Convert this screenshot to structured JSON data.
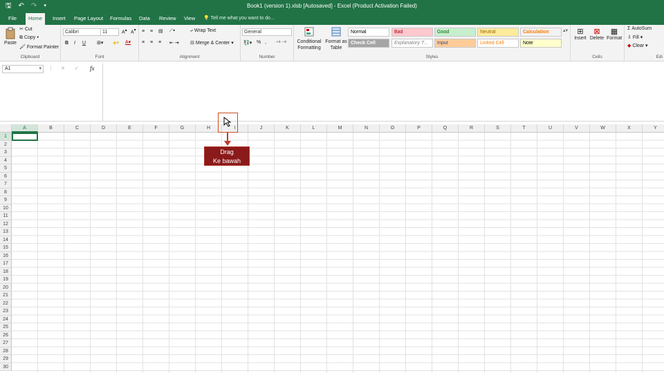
{
  "window": {
    "title": "Book1 (version 1).xlsb [Autosaved] - Excel (Product Activation Failed)"
  },
  "qat": {
    "save": "🖫",
    "undo": "↶",
    "redo": "↷",
    "more": "▾"
  },
  "tabs": [
    "File",
    "Home",
    "Insert",
    "Page Layout",
    "Formulas",
    "Data",
    "Review",
    "View"
  ],
  "active_tab": "Home",
  "tell_me": "Tell me what you want to do...",
  "clipboard": {
    "paste": "Paste",
    "cut": "Cut",
    "copy": "Copy",
    "format_painter": "Format Painter",
    "label": "Clipboard"
  },
  "font": {
    "name": "Calibri",
    "size": "11",
    "bold": "B",
    "italic": "I",
    "underline": "U",
    "label": "Font"
  },
  "alignment": {
    "wrap": "Wrap Text",
    "merge": "Merge & Center",
    "label": "Alignment"
  },
  "number": {
    "format": "General",
    "percent": "%",
    "comma": ",",
    "label": "Number"
  },
  "styles": {
    "conditional": [
      "Conditional",
      "Formatting"
    ],
    "format_table": [
      "Format as",
      "Table"
    ],
    "cells": [
      {
        "label": "Normal",
        "bg": "#ffffff",
        "fg": "#000000"
      },
      {
        "label": "Bad",
        "bg": "#ffc7ce",
        "fg": "#9c0006"
      },
      {
        "label": "Good",
        "bg": "#c6efce",
        "fg": "#006100"
      },
      {
        "label": "Neutral",
        "bg": "#ffeb9c",
        "fg": "#9c6500"
      },
      {
        "label": "Calculation",
        "bg": "#f2f2f2",
        "fg": "#fa7d00"
      },
      {
        "label": "Check Cell",
        "bg": "#a5a5a5",
        "fg": "#ffffff"
      },
      {
        "label": "Explanatory T...",
        "bg": "#ffffff",
        "fg": "#7f7f7f"
      },
      {
        "label": "Input",
        "bg": "#ffcc99",
        "fg": "#3f3f76"
      },
      {
        "label": "Linked Cell",
        "bg": "#ffffff",
        "fg": "#fa7d00"
      },
      {
        "label": "Note",
        "bg": "#ffffcc",
        "fg": "#000000"
      }
    ],
    "label": "Styles"
  },
  "cells_group": {
    "insert": "Insert",
    "delete": "Delete",
    "format": "Format",
    "label": "Cells"
  },
  "editing": {
    "autosum": "AutoSum",
    "fill": "Fill",
    "clear": "Clear",
    "label": "Edi"
  },
  "name_box": "A1",
  "fx": "fx",
  "columns": [
    "A",
    "B",
    "C",
    "D",
    "E",
    "F",
    "G",
    "H",
    "I",
    "J",
    "K",
    "L",
    "M",
    "N",
    "O",
    "P",
    "Q",
    "R",
    "S",
    "T",
    "U",
    "V",
    "W",
    "X",
    "Y"
  ],
  "rows": [
    "1",
    "2",
    "3",
    "4",
    "5",
    "6",
    "7",
    "8",
    "9",
    "10",
    "11",
    "12",
    "13",
    "14",
    "15",
    "16",
    "17",
    "18",
    "19",
    "20",
    "21",
    "22",
    "23",
    "24",
    "25",
    "26",
    "27",
    "28",
    "29",
    "30"
  ],
  "annotation": {
    "line1": "Drag",
    "line2": "Ke bawah"
  },
  "accent": "#217346"
}
